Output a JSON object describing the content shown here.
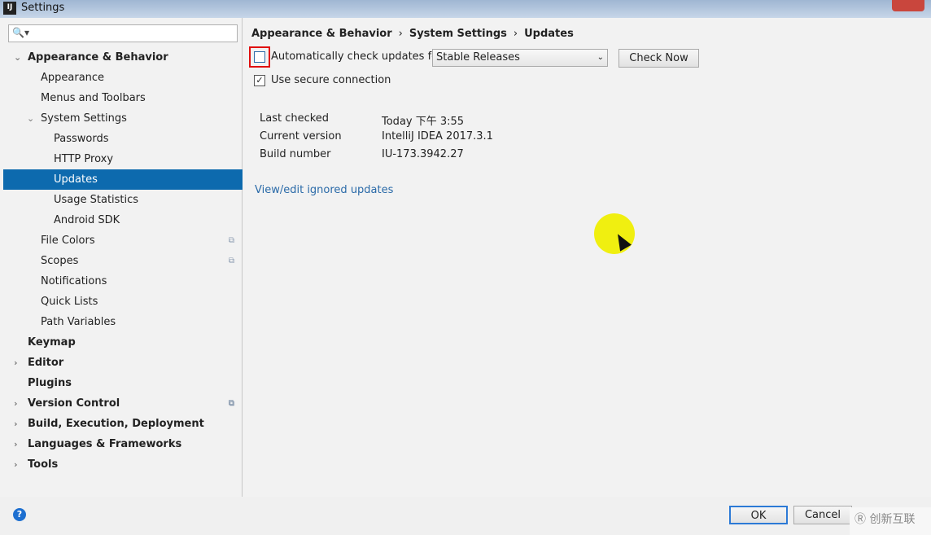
{
  "window": {
    "title": "Settings",
    "logo": "IJ"
  },
  "search": {
    "placeholder": "",
    "icon": "search-icon"
  },
  "sidebar": {
    "items": [
      {
        "label": "Appearance & Behavior",
        "level": 0,
        "expanded": true,
        "bold": true
      },
      {
        "label": "Appearance",
        "level": 1
      },
      {
        "label": "Menus and Toolbars",
        "level": 1
      },
      {
        "label": "System Settings",
        "level": 1,
        "expanded": true
      },
      {
        "label": "Passwords",
        "level": 2
      },
      {
        "label": "HTTP Proxy",
        "level": 2
      },
      {
        "label": "Updates",
        "level": 2,
        "selected": true
      },
      {
        "label": "Usage Statistics",
        "level": 2
      },
      {
        "label": "Android SDK",
        "level": 2
      },
      {
        "label": "File Colors",
        "level": 1,
        "project": true
      },
      {
        "label": "Scopes",
        "level": 1,
        "project": true
      },
      {
        "label": "Notifications",
        "level": 1
      },
      {
        "label": "Quick Lists",
        "level": 1
      },
      {
        "label": "Path Variables",
        "level": 1
      },
      {
        "label": "Keymap",
        "level": 0,
        "bold": true
      },
      {
        "label": "Editor",
        "level": 0,
        "bold": true,
        "collapsed": true
      },
      {
        "label": "Plugins",
        "level": 0,
        "bold": true
      },
      {
        "label": "Version Control",
        "level": 0,
        "bold": true,
        "collapsed": true,
        "project": true
      },
      {
        "label": "Build, Execution, Deployment",
        "level": 0,
        "bold": true,
        "collapsed": true
      },
      {
        "label": "Languages & Frameworks",
        "level": 0,
        "bold": true,
        "collapsed": true
      },
      {
        "label": "Tools",
        "level": 0,
        "bold": true,
        "collapsed": true
      }
    ]
  },
  "breadcrumb": [
    "Appearance & Behavior",
    "System Settings",
    "Updates"
  ],
  "updates": {
    "auto_check_label": "Automatically check updates for",
    "auto_check": false,
    "channel": "Stable Releases",
    "check_now": "Check Now",
    "secure_label": "Use secure connection",
    "secure": true,
    "info": [
      {
        "label": "Last checked",
        "value": "Today 下午 3:55"
      },
      {
        "label": "Current version",
        "value": "IntelliJ IDEA 2017.3.1"
      },
      {
        "label": "Build number",
        "value": "IU-173.3942.27"
      }
    ],
    "ignored_link": "View/edit ignored updates"
  },
  "footer": {
    "ok": "OK",
    "cancel": "Cancel",
    "help": "?",
    "watermark": "创新互联"
  }
}
